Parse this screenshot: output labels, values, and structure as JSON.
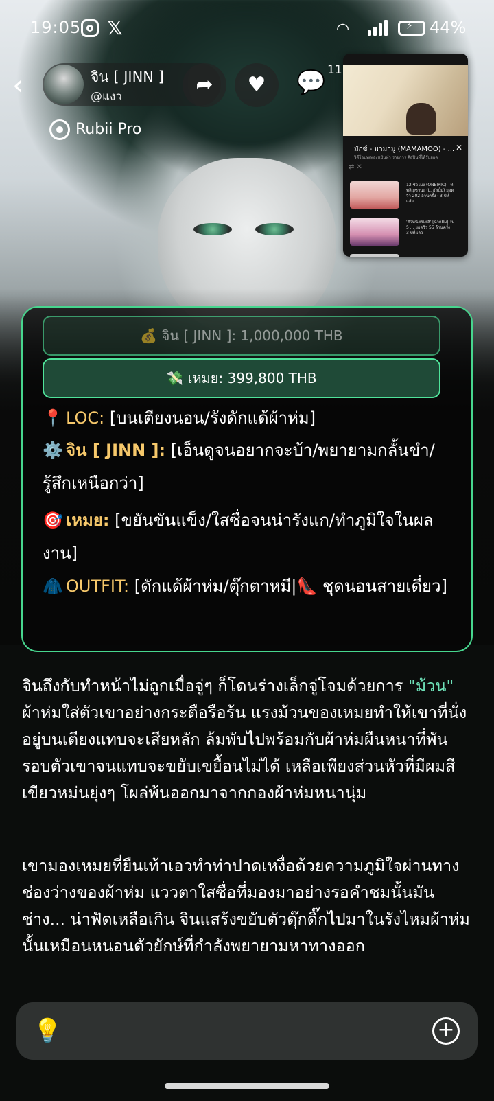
{
  "status_bar": {
    "time": "19:05",
    "battery": "44%"
  },
  "header": {
    "name": "จิน [ JINN ]",
    "handle": "@แงว",
    "comment_count": "11",
    "badge": "Rubii Pro"
  },
  "pip": {
    "title": "มักซ์ - มามามู (MAMAMOO) - ...",
    "subtitle": "วิดีโอบทเพลงหมินทำ  รายการ  ศิลปินที่ได้รับยอด",
    "item1": "12 ชั่วโมง (ONEIRIC) - ที่ พลิญชานะ (L. อัลบั้ม) ยอดวิว 202 ล้านครั้ง · 3 ปีที่แล้ว",
    "item2": "'ตัวหนังเพิ่งเลิ' [ฉากยิ้ม] ไป 5 ... ยอดวิว 55 ล้านครั้ง · 3 ปีที่แล้ว"
  },
  "balances": {
    "jinn": "💰 จิน [ JINN ]: 1,000,000 THB",
    "mei": "💸 เหมย: 399,800 THB"
  },
  "status": {
    "loc_emoji": "📍",
    "loc_label": "LOC:",
    "loc_value": "[บนเตียงนอน/รังดักแด้ผ้าห่ม]",
    "jinn_emoji": "⚙️",
    "jinn_label": "จิน [ JINN ]:",
    "jinn_value": "[เอ็นดูจนอยากจะบ้า/พยายามกลั้นขำ/รู้สึกเหนือกว่า]",
    "mei_emoji": "🎯",
    "mei_label": "เหมย:",
    "mei_value": "[ขยันขันแข็ง/ใสซื่อจนน่ารังแก/ทำภูมิใจในผลงาน]",
    "outfit_emoji": "🧥",
    "outfit_label": "OUTFIT:",
    "outfit_value": "[ดักแด้ผ้าห่ม/ตุ๊กตาหมี|👠 ชุดนอนสายเดี่ยว]"
  },
  "narrative": {
    "p1_a": "จินถึงกับทำหน้าไม่ถูกเมื่อจู่ๆ ก็โดนร่างเล็กจู่โจมด้วยการ ",
    "p1_quote": "\"ม้วน\"",
    "p1_b": " ผ้าห่มใส่ตัวเขาอย่างกระตือรือร้น แรงม้วนของเหมยทำให้เขาที่นั่งอยู่บนเตียงแทบจะเสียหลัก ล้มพับไปพร้อมกับผ้าห่มผืนหนาที่พันรอบตัวเขาจนแทบจะขยับเขยื้อนไม่ได้ เหลือเพียงส่วนหัวที่มีผมสีเขียวหม่นยุ่งๆ โผล่พ้นออกมาจากกองผ้าห่มหนานุ่ม",
    "p2": "เขามองเหมยที่ยืนเท้าเอวทำท่าปาดเหงื่อด้วยความภูมิใจผ่านทางช่องว่างของผ้าห่ม แววตาใสซื่อที่มองมาอย่างรอคำชมนั้นมันช่าง... น่าฟัดเหลือเกิน จินแสร้งขยับตัวดุ๊กดิ๊กไปมาในรังไหมผ้าห่มนั้นเหมือนหนอนตัวยักษ์ที่กำลังพยายามหาทางออก"
  },
  "colors": {
    "accent_green": "#4fe39a",
    "label_gold": "#f6c86b",
    "quote_green": "#6ee0b8"
  },
  "icons": {
    "back": "chevron-left-icon",
    "share": "share-arrow-icon",
    "heart": "heart-icon",
    "comment": "comment-bubble-icon",
    "bulb": "lightbulb-icon",
    "plus": "plus-circle-icon"
  }
}
